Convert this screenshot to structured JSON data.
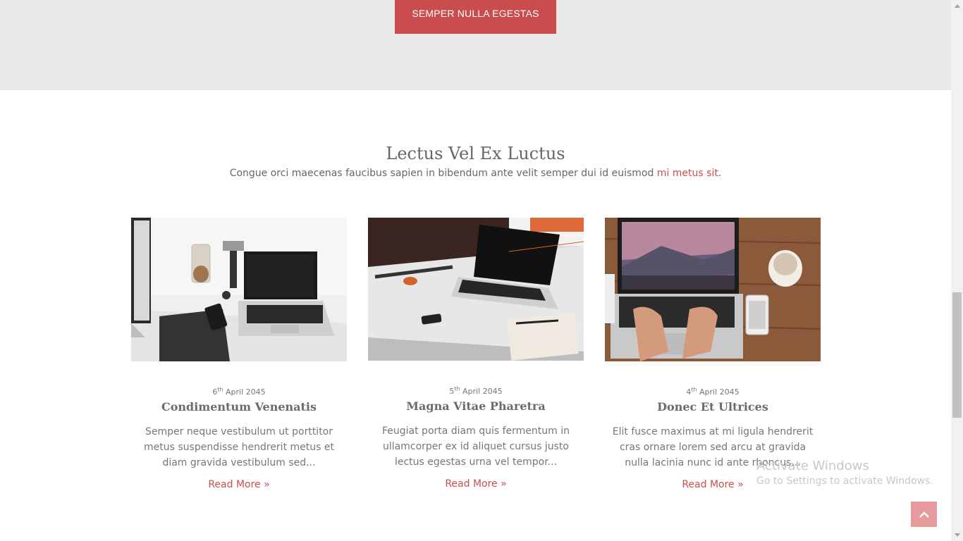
{
  "cta": {
    "label": "SEMPER NULLA EGESTAS"
  },
  "section": {
    "title": "Lectus Vel Ex Luctus",
    "subtitle": "Congue orci maecenas faucibus sapien in bibendum ante velit semper dui id euismod ",
    "subtitle_link": "mi metus sit",
    "subtitle_end": "."
  },
  "posts": [
    {
      "day": "6",
      "suffix": "th",
      "month_year": "April 2045",
      "title": "Condimentum Venenatis",
      "excerpt": "Semper neque vestibulum ut porttitor metus suspendisse hendrerit metus et diam gravida vestibulum sed...",
      "read_more": "Read More »"
    },
    {
      "day": "5",
      "suffix": "th",
      "month_year": "April 2045",
      "title": "Magna Vitae Pharetra",
      "excerpt": "Feugiat porta diam quis fermentum in ullamcorper ex id aliquet cursus justo lectus egestas urna vel tempor...",
      "read_more": "Read More »"
    },
    {
      "day": "4",
      "suffix": "th",
      "month_year": "April 2045",
      "title": "Donec Et Ultrices",
      "excerpt": "Elit fusce maximus at mi ligula hendrerit cras ornare lorem sed arcu at gravida nulla lacinia nunc id ante rhoncus...",
      "read_more": "Read More »"
    }
  ],
  "watermark": {
    "line1": "Activate Windows",
    "line2": "Go to Settings to activate Windows."
  },
  "colors": {
    "accent": "#c94c4f",
    "band": "#e9e9e9",
    "scroll_top": "#e79a9c"
  },
  "icons": {
    "scroll_top": "chevron-up-icon"
  }
}
